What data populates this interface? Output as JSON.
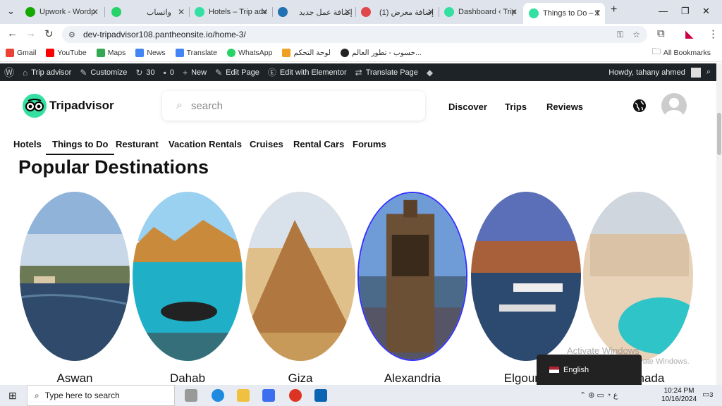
{
  "browser": {
    "tabs": [
      {
        "title": "Upwork - Wordp",
        "color": "#14a800"
      },
      {
        "title": "واتساب",
        "color": "#25d366"
      },
      {
        "title": "Hotels – Trip adv",
        "color": "#34e0a1"
      },
      {
        "title": "إضافة عمل جديد",
        "color": "#2271b1"
      },
      {
        "title": "(1) إضافة معرض",
        "color": "#e0474c"
      },
      {
        "title": "Dashboard ‹ Trip",
        "color": "#34e0a1"
      },
      {
        "title": "Things to Do – T",
        "color": "#34e0a1"
      }
    ],
    "address": "dev-tripadvisor108.pantheonsite.io/home-3/",
    "bookmarks": [
      "Gmail",
      "YouTube",
      "Maps",
      "News",
      "Translate",
      "WhatsApp",
      "لوحة التحكم",
      "حسوب - تطور العالم..."
    ],
    "all_bookmarks": "All Bookmarks"
  },
  "wp_admin": {
    "site": "Trip advisor",
    "customize": "Customize",
    "updates": "30",
    "comments": "0",
    "new": "New",
    "edit_page": "Edit Page",
    "elementor": "Edit with Elementor",
    "translate": "Translate Page",
    "howdy": "Howdy, tahany ahmed"
  },
  "site": {
    "logo": "Tripadvisor",
    "search_placeholder": "search",
    "nav": [
      "Discover",
      "Trips",
      "Reviews"
    ],
    "categories": [
      "Hotels",
      "Things to Do",
      "Resturant",
      "Vacation Rentals",
      "Cruises",
      "Rental Cars",
      "Forums"
    ],
    "heading": "Popular Destinations",
    "destinations": [
      "Aswan",
      "Dahab",
      "Giza",
      "Alexandria",
      "Elgouna",
      "Hurghada"
    ]
  },
  "overlay": {
    "watermark1": "Activate Windows",
    "watermark2": "Go to Settings to activate Windows.",
    "language": "English"
  },
  "taskbar": {
    "search": "Type here to search",
    "time": "10:24 PM",
    "date": "10/16/2024",
    "notif_count": "3"
  }
}
